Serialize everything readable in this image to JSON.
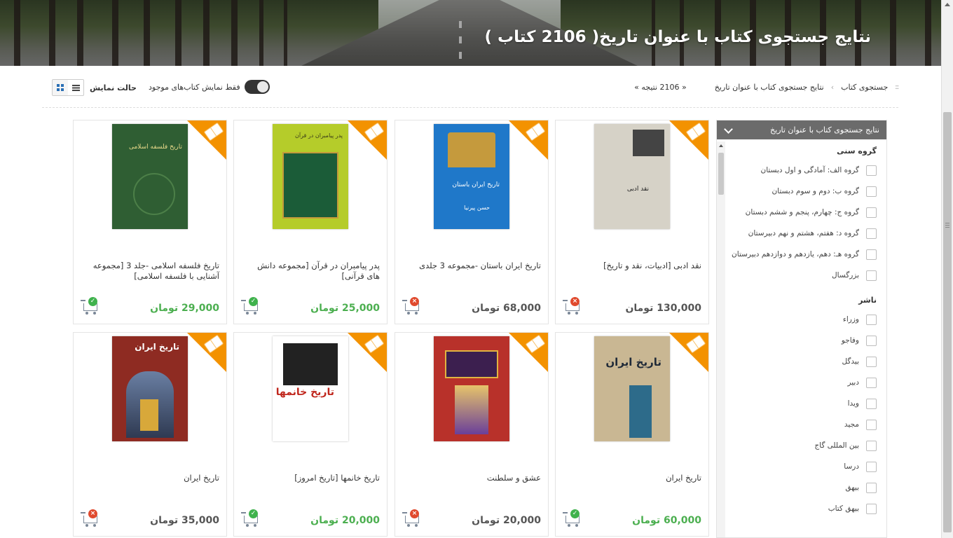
{
  "header": {
    "title": "نتایج جستجوی کتاب با عنوان تاریخ( 2106 کتاب )"
  },
  "breadcrumb": {
    "items": [
      "جستجوی کتاب",
      "نتایج جستجوی کتاب با عنوان تاریخ"
    ],
    "count": "« 2106 نتیجه »"
  },
  "toolbar": {
    "available_toggle_label": "فقط نمایش کتاب‌های موجود",
    "view_mode_label": "حالت نمایش"
  },
  "sidebar": {
    "header": "نتایج جستجوی کتاب با عنوان تاریخ",
    "groups": [
      {
        "title": "گروه سنی",
        "options": [
          "گروه الف: آمادگی و اول دبستان",
          "گروه ب: دوم و سوم دبستان",
          "گروه ج: چهارم، پنجم و ششم دبستان",
          "گروه د: هفتم، هشتم و نهم دبیرستان",
          "گروه هـ: دهم، یازدهم و دوازدهم دبیرستان",
          "بزرگسال"
        ]
      },
      {
        "title": "ناشر",
        "options": [
          "وزراء",
          "وفاجو",
          "بیدگل",
          "دبیر",
          "ویدا",
          "مجید",
          "بین المللی گاج",
          "درسا",
          "بیهق",
          "بیهق کتاب"
        ]
      }
    ]
  },
  "products": [
    {
      "title": "نقد ادبی [ادبیات، نقد و تاریخ]",
      "price": "130,000 تومان",
      "in_stock": false
    },
    {
      "title": "تاریخ ایران باستان -مجموعه 3 جلدی",
      "price": "68,000 تومان",
      "in_stock": false
    },
    {
      "title": "پدر پیامبران در قرآن [مجموعه دانش های قرآنی]",
      "price": "25,000 تومان",
      "in_stock": true
    },
    {
      "title": "تاریخ فلسفه اسلامی -جلد 3 [مجموعه آشنایی با فلسفه اسلامی]",
      "price": "29,000 تومان",
      "in_stock": true
    },
    {
      "title": "تاریخ ایران",
      "price": "60,000 تومان",
      "in_stock": true
    },
    {
      "title": "عشق و سلطنت",
      "price": "20,000 تومان",
      "in_stock": false
    },
    {
      "title": "تاریخ خانمها [تاریخ امروز]",
      "price": "20,000 تومان",
      "in_stock": true
    },
    {
      "title": "تاریخ ایران",
      "price": "35,000 تومان",
      "in_stock": false
    }
  ],
  "covers": [
    {
      "text": "نقد ادبی"
    },
    {
      "text": "تاریخ ایران باستان",
      "sub": "حسن پیرنیا"
    },
    {
      "text": "پدر پیامبران در قرآن"
    },
    {
      "text": "تاریخ فلسفه اسلامی"
    },
    {
      "text": "تاریخ ایران"
    },
    {
      "text": ""
    },
    {
      "text": "تاریخ خانمها"
    },
    {
      "text": "تاریخ ایران"
    }
  ],
  "colors": {
    "accent_orange": "#f39200",
    "in_stock_green": "#4caf50",
    "out_of_stock_red": "#e04a2e",
    "sidebar_header": "#6b6b6b"
  }
}
